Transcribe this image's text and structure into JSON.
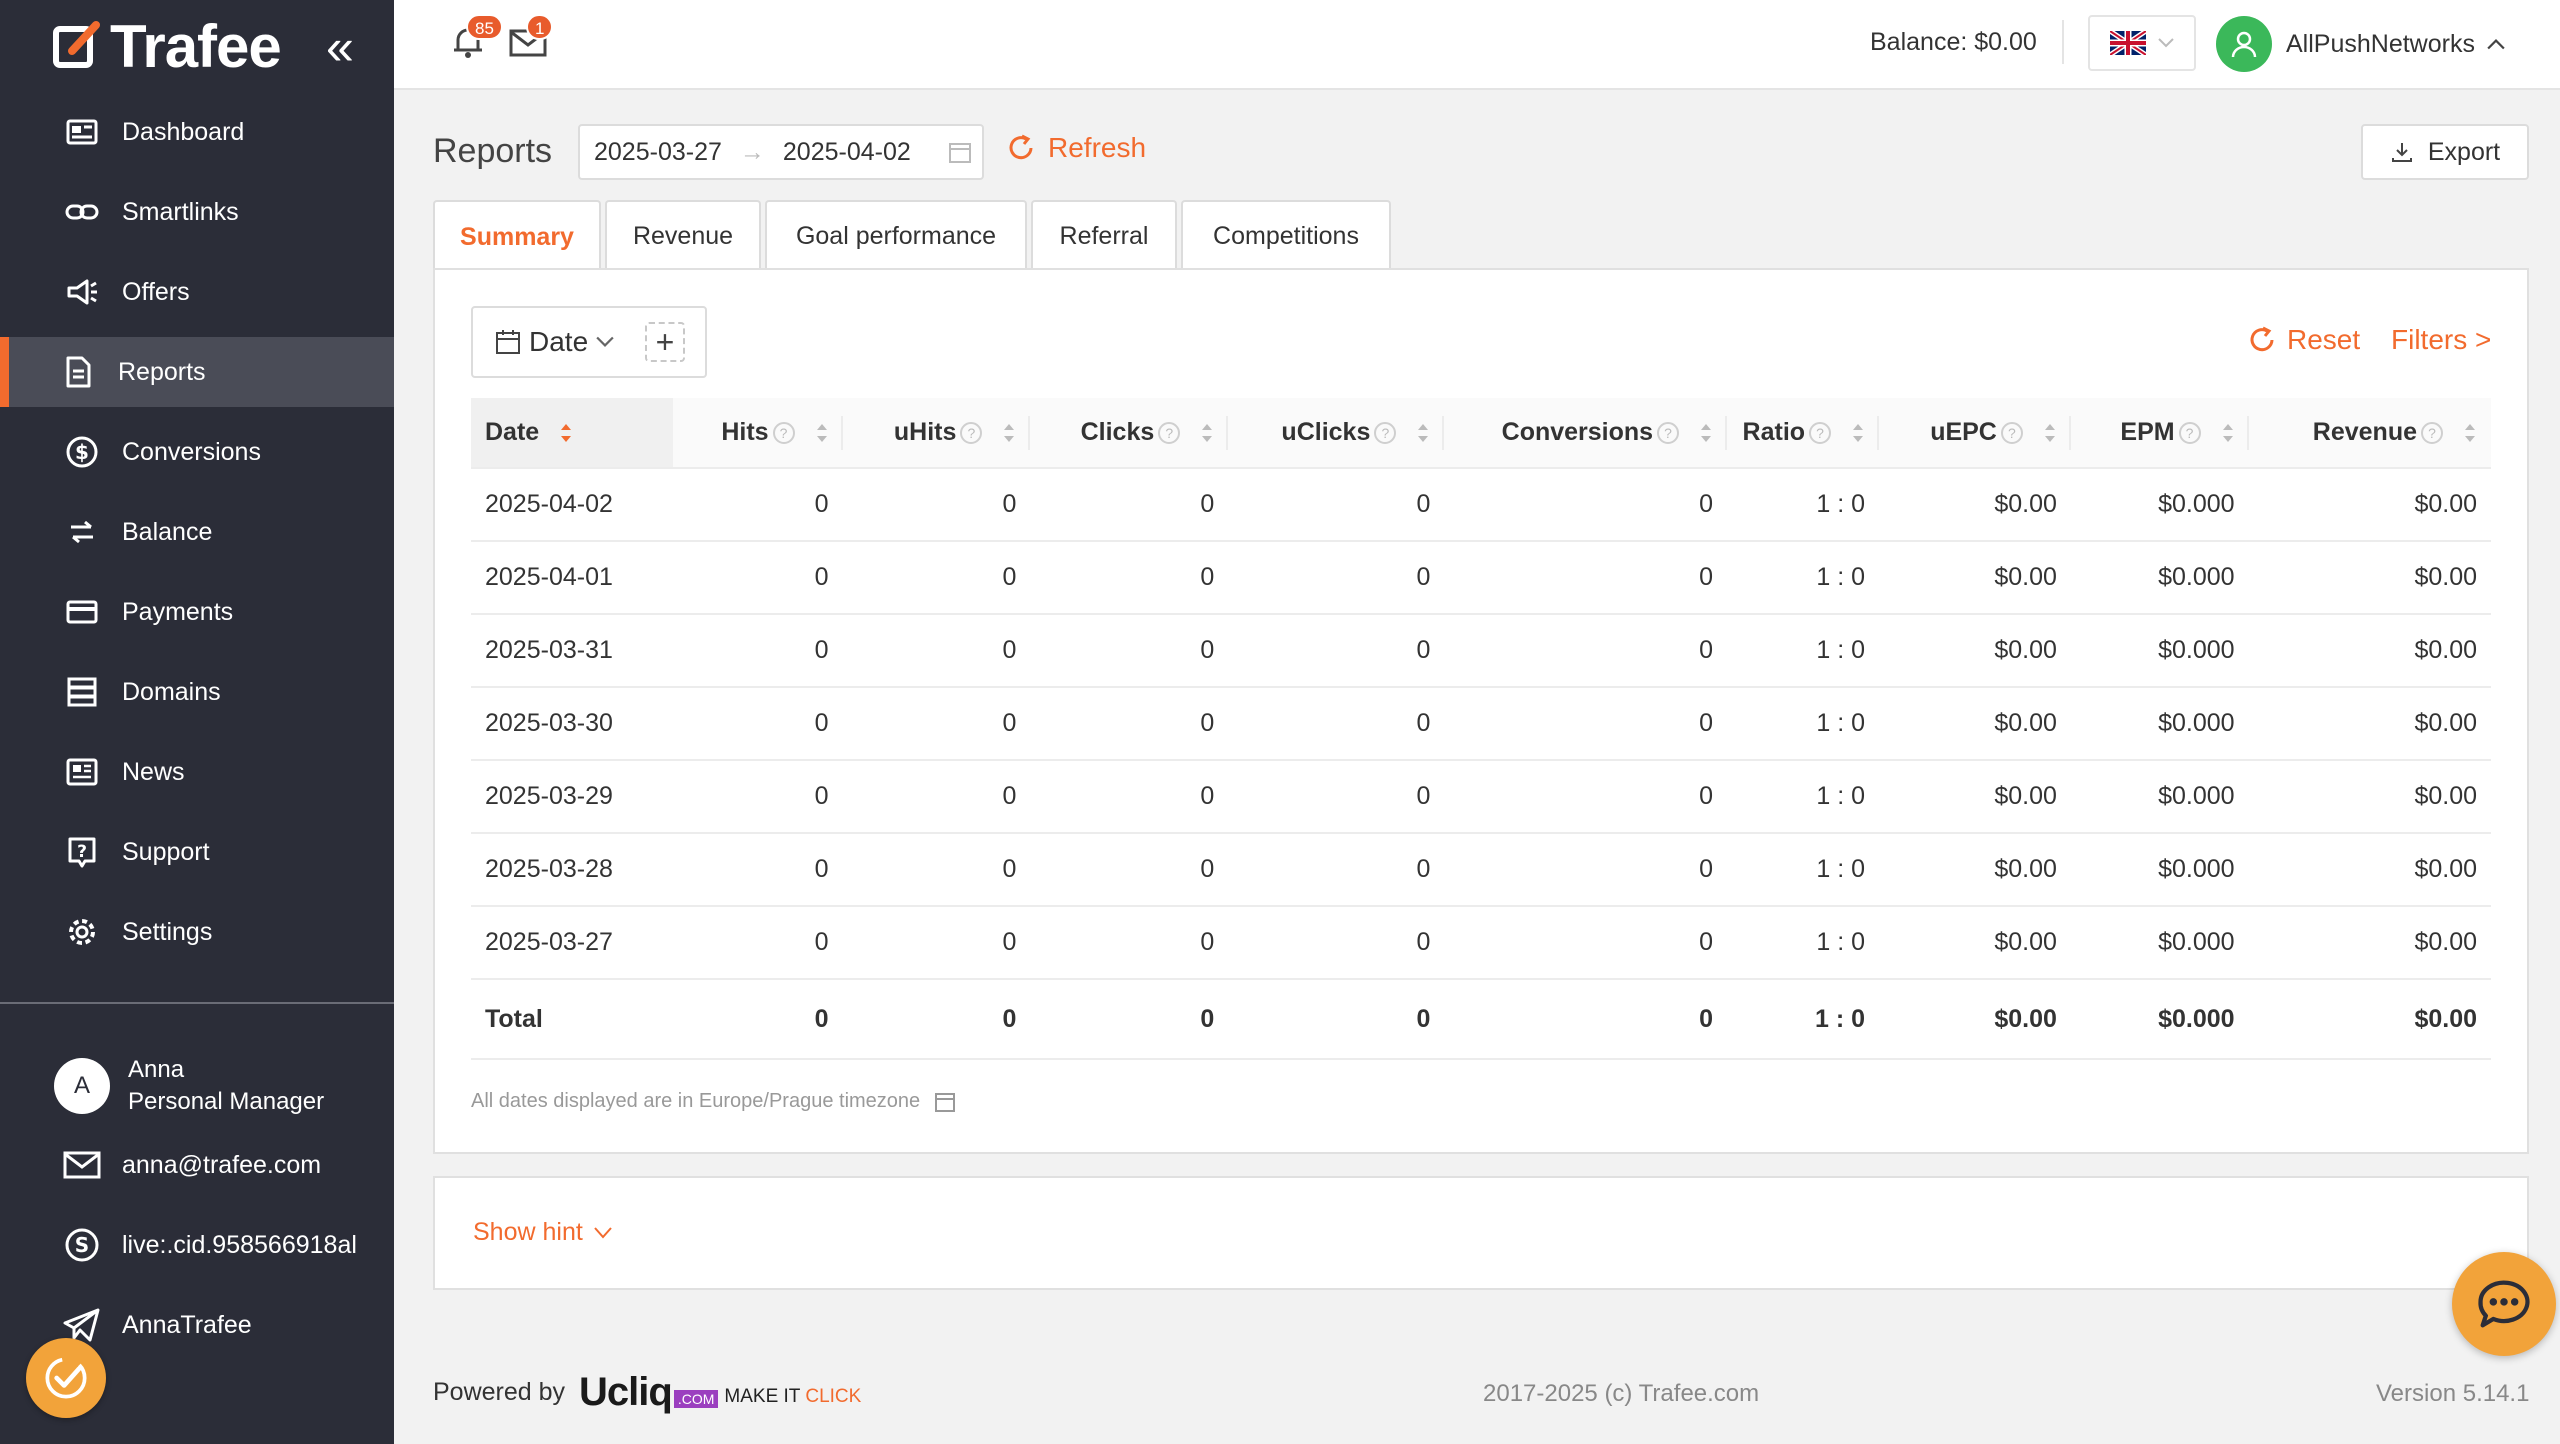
{
  "brand": {
    "name": "Trafee"
  },
  "sidebar": {
    "items": [
      {
        "label": "Dashboard",
        "icon": "dashboard-icon"
      },
      {
        "label": "Smartlinks",
        "icon": "link-icon"
      },
      {
        "label": "Offers",
        "icon": "megaphone-icon"
      },
      {
        "label": "Reports",
        "icon": "document-icon",
        "active": true
      },
      {
        "label": "Conversions",
        "icon": "dollar-icon"
      },
      {
        "label": "Balance",
        "icon": "exchange-icon"
      },
      {
        "label": "Payments",
        "icon": "card-icon"
      },
      {
        "label": "Domains",
        "icon": "server-icon"
      },
      {
        "label": "News",
        "icon": "newspaper-icon"
      },
      {
        "label": "Support",
        "icon": "question-icon"
      },
      {
        "label": "Settings",
        "icon": "gear-icon"
      }
    ],
    "manager": {
      "initial": "A",
      "name": "Anna",
      "role": "Personal Manager"
    },
    "contacts": {
      "email": "anna@trafee.com",
      "skype": "live:.cid.958566918al",
      "telegram": "AnnaTrafee"
    }
  },
  "header": {
    "notifications_count": "85",
    "messages_count": "1",
    "balance": "Balance: $0.00",
    "user": "AllPushNetworks"
  },
  "page": {
    "title": "Reports",
    "date_from": "2025-03-27",
    "date_to": "2025-04-02",
    "refresh_label": "Refresh",
    "export_label": "Export"
  },
  "tabs": [
    {
      "label": "Summary",
      "active": true
    },
    {
      "label": "Revenue"
    },
    {
      "label": "Goal performance"
    },
    {
      "label": "Referral"
    },
    {
      "label": "Competitions"
    }
  ],
  "toolbar": {
    "group_label": "Date",
    "add_label": "+",
    "reset_label": "Reset",
    "filters_label": "Filters >"
  },
  "table": {
    "columns": [
      "Date",
      "Hits",
      "uHits",
      "Clicks",
      "uClicks",
      "Conversions",
      "Ratio",
      "uEPC",
      "EPM",
      "Revenue"
    ],
    "rows": [
      [
        "2025-04-02",
        "0",
        "0",
        "0",
        "0",
        "0",
        "1 : 0",
        "$0.00",
        "$0.000",
        "$0.00"
      ],
      [
        "2025-04-01",
        "0",
        "0",
        "0",
        "0",
        "0",
        "1 : 0",
        "$0.00",
        "$0.000",
        "$0.00"
      ],
      [
        "2025-03-31",
        "0",
        "0",
        "0",
        "0",
        "0",
        "1 : 0",
        "$0.00",
        "$0.000",
        "$0.00"
      ],
      [
        "2025-03-30",
        "0",
        "0",
        "0",
        "0",
        "0",
        "1 : 0",
        "$0.00",
        "$0.000",
        "$0.00"
      ],
      [
        "2025-03-29",
        "0",
        "0",
        "0",
        "0",
        "0",
        "1 : 0",
        "$0.00",
        "$0.000",
        "$0.00"
      ],
      [
        "2025-03-28",
        "0",
        "0",
        "0",
        "0",
        "0",
        "1 : 0",
        "$0.00",
        "$0.000",
        "$0.00"
      ],
      [
        "2025-03-27",
        "0",
        "0",
        "0",
        "0",
        "0",
        "1 : 0",
        "$0.00",
        "$0.000",
        "$0.00"
      ]
    ],
    "total": [
      "Total",
      "0",
      "0",
      "0",
      "0",
      "0",
      "1 : 0",
      "$0.00",
      "$0.000",
      "$0.00"
    ]
  },
  "timezone_note": "All dates displayed are in Europe/Prague timezone",
  "hint_label": "Show hint",
  "footer": {
    "powered_by": "Powered by",
    "ucliq_brand": "Ucliq",
    "ucliq_com": ".COM",
    "ucliq_tagline_a": "MAKE IT",
    "ucliq_tagline_b": "CLICK",
    "copyright": "2017-2025 (c) Trafee.com",
    "version": "Version 5.14.1"
  },
  "colors": {
    "accent": "#f26b2e",
    "sidebar": "#2b2d38",
    "avatar": "#3bb85a",
    "badge": "#e85b2c"
  }
}
